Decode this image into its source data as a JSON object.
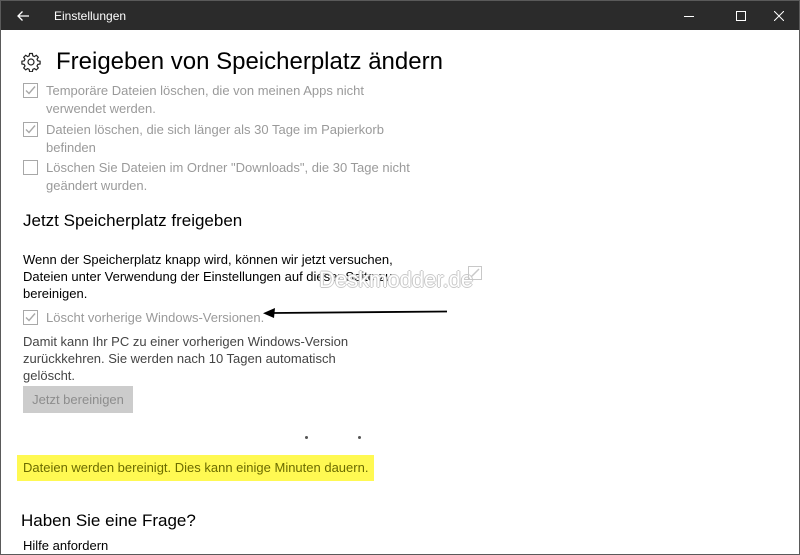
{
  "window": {
    "title": "Einstellungen",
    "back_icon": "arrow-left-icon",
    "minimize_icon": "minimize-icon",
    "maximize_icon": "maximize-icon",
    "close_icon": "close-icon",
    "titlebar_color": "#2b2b2b"
  },
  "page": {
    "title": "Freigeben von Speicherplatz ändern",
    "icon": "gear-icon"
  },
  "options": [
    {
      "label": "Temporäre Dateien löschen, die von meinen Apps nicht verwendet werden.",
      "checked": true
    },
    {
      "label": "Dateien löschen, die sich länger als 30 Tage im Papierkorb befinden",
      "checked": true
    },
    {
      "label": "Löschen Sie Dateien im Ordner \"Downloads\", die 30 Tage nicht geändert wurden.",
      "checked": false
    }
  ],
  "free_now": {
    "heading": "Jetzt Speicherplatz freigeben",
    "description": "Wenn der Speicherplatz knapp wird, können wir jetzt versuchen, Dateien unter Verwendung der Einstellungen auf dieser Seite zu bereinigen.",
    "windows_versions_label": "Löscht vorherige Windows-Versionen.",
    "windows_versions_checked": true,
    "windows_versions_note": "Damit kann Ihr PC zu einer vorherigen Windows-Version zurückkehren. Sie werden nach 10 Tagen automatisch gelöscht.",
    "button_label": "Jetzt bereinigen",
    "status": "Dateien werden bereinigt. Dies kann einige Minuten dauern.",
    "status_highlight_color": "#fff952"
  },
  "watermark": "Deskmodder.de",
  "faq": {
    "heading": "Haben Sie eine Frage?",
    "help_link": "Hilfe anfordern"
  }
}
